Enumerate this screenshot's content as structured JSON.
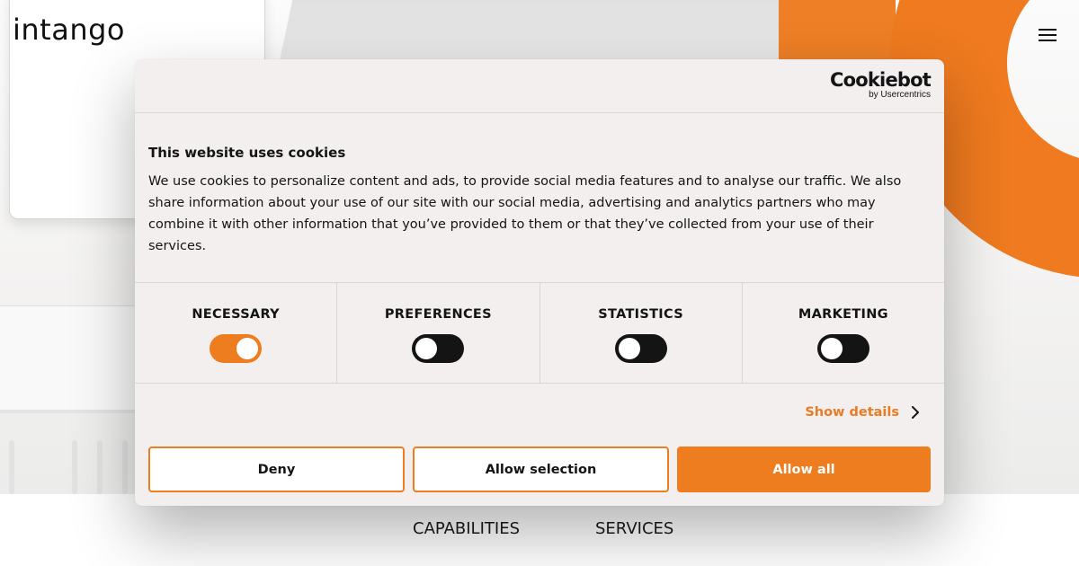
{
  "site": {
    "logo_text": "intango",
    "nav": [
      "CAPABILITIES",
      "SERVICES"
    ]
  },
  "cookie_dialog": {
    "brand_name": "Cookiebot",
    "brand_sub": "by Usercentrics",
    "title": "This website uses cookies",
    "body": "We use cookies to personalize content and ads, to provide social media features and to analyse our traffic. We also share information about your use of our site with our social media, advertising and analytics partners who may combine it with other information that you’ve provided to them or that they’ve collected from your use of their services.",
    "categories": [
      {
        "label": "NECESSARY",
        "enabled": true
      },
      {
        "label": "PREFERENCES",
        "enabled": false
      },
      {
        "label": "STATISTICS",
        "enabled": false
      },
      {
        "label": "MARKETING",
        "enabled": false
      }
    ],
    "show_details_label": "Show details",
    "buttons": {
      "deny": "Deny",
      "allow_selection": "Allow selection",
      "allow_all": "Allow all"
    }
  },
  "colors": {
    "accent": "#ee7d20",
    "toggle_off": "#141414",
    "dialog_bg": "#f2efee"
  },
  "icons": {
    "menu": "hamburger-icon",
    "details": "chevron-right-icon"
  }
}
